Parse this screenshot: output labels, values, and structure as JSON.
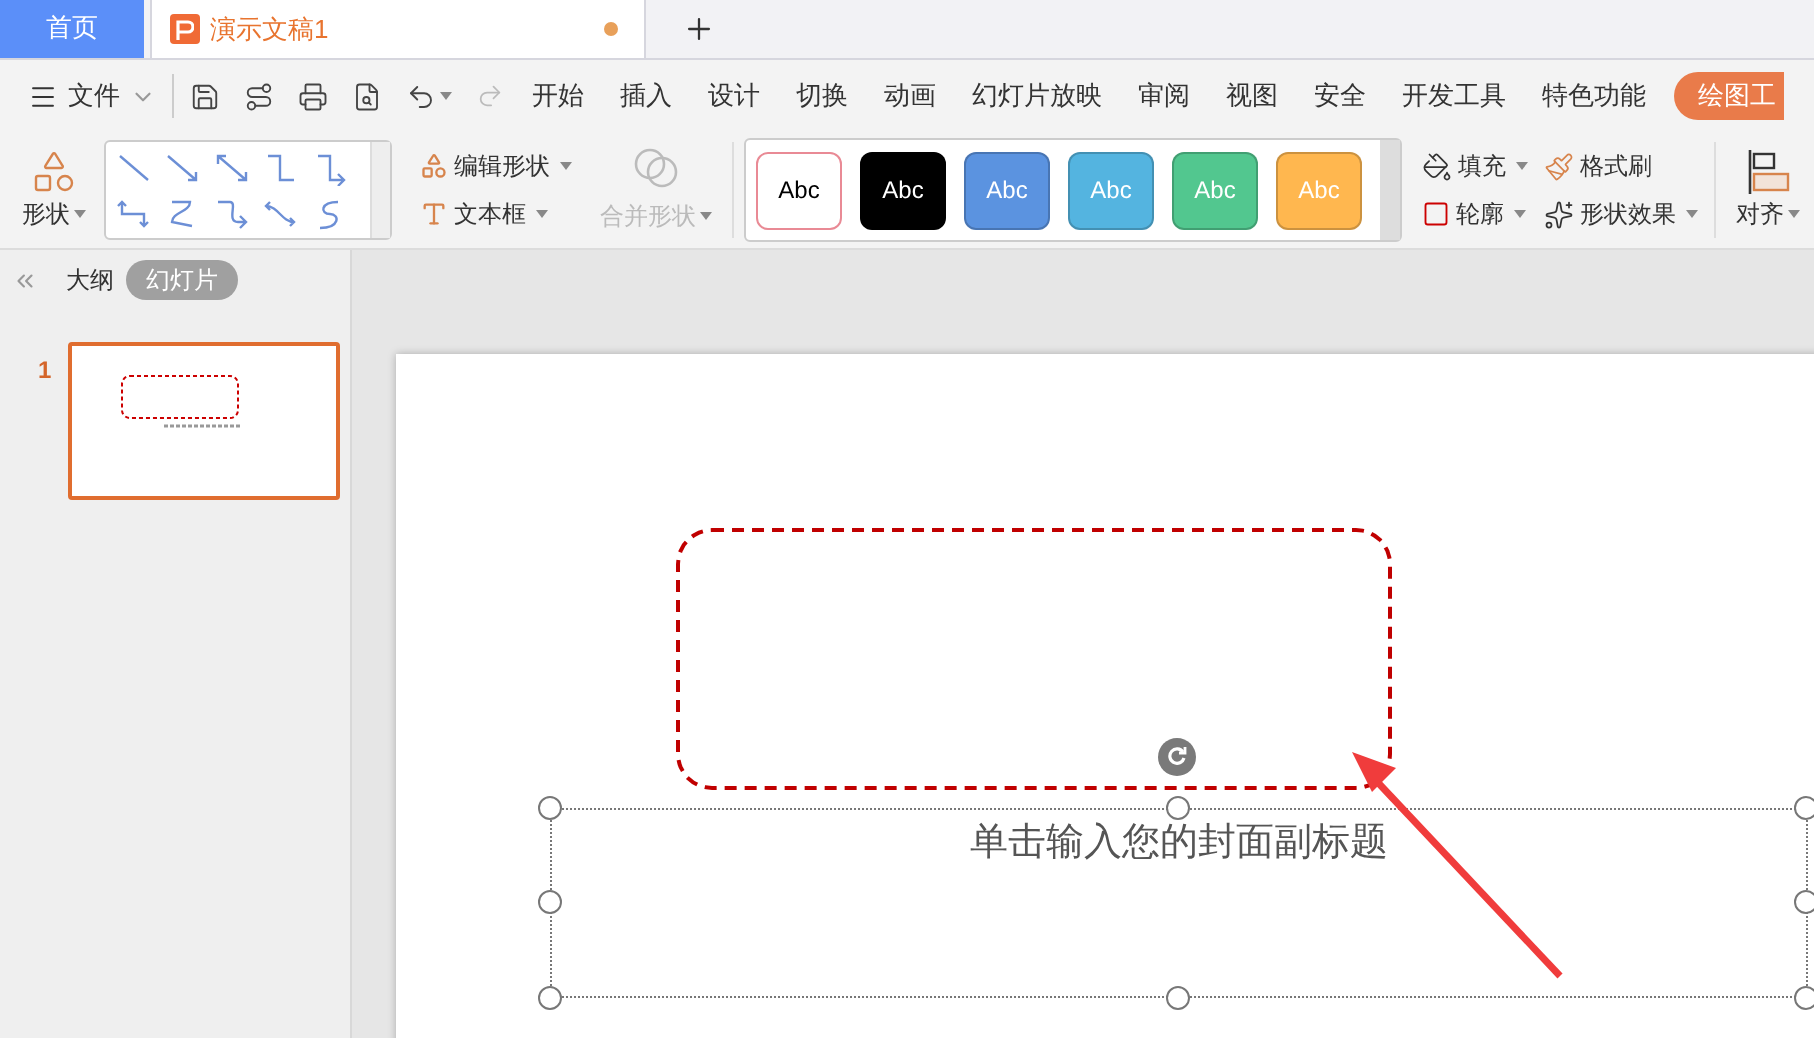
{
  "tabs": [
    {
      "label": "首页",
      "kind": "home",
      "selected": false
    },
    {
      "label": "演示文稿1",
      "kind": "document",
      "selected": true,
      "modified": true
    }
  ],
  "menu": {
    "file": "文件",
    "ribbon_tabs": [
      {
        "label": "开始",
        "selected": false
      },
      {
        "label": "插入",
        "selected": false
      },
      {
        "label": "设计",
        "selected": false
      },
      {
        "label": "切换",
        "selected": false
      },
      {
        "label": "动画",
        "selected": false
      },
      {
        "label": "幻灯片放映",
        "selected": false
      },
      {
        "label": "审阅",
        "selected": false
      },
      {
        "label": "视图",
        "selected": false
      },
      {
        "label": "安全",
        "selected": false
      },
      {
        "label": "开发工具",
        "selected": false
      },
      {
        "label": "特色功能",
        "selected": false
      },
      {
        "label": "绘图工",
        "selected": true
      }
    ]
  },
  "ribbon": {
    "shapes": "形状",
    "edit_shape": "编辑形状",
    "text_box": "文本框",
    "merge_shapes": {
      "label": "合并形状",
      "disabled": true
    },
    "styles": [
      {
        "label": "Abc",
        "color": "#ffffff"
      },
      {
        "label": "Abc",
        "color": "#000000"
      },
      {
        "label": "Abc",
        "color": "#5b93e0"
      },
      {
        "label": "Abc",
        "color": "#54b4e0"
      },
      {
        "label": "Abc",
        "color": "#52c78f"
      },
      {
        "label": "Abc",
        "color": "#ffb74f"
      }
    ],
    "fill": "填充",
    "format_painter": "格式刷",
    "outline": "轮廓",
    "shape_effects": "形状效果",
    "align": "对齐"
  },
  "panel": {
    "views": [
      {
        "label": "大纲",
        "selected": false
      },
      {
        "label": "幻灯片",
        "selected": true
      }
    ],
    "slides": [
      {
        "number": "1",
        "selected": true
      }
    ]
  },
  "slide": {
    "subtitle_placeholder": "单击输入您的封面副标题"
  }
}
